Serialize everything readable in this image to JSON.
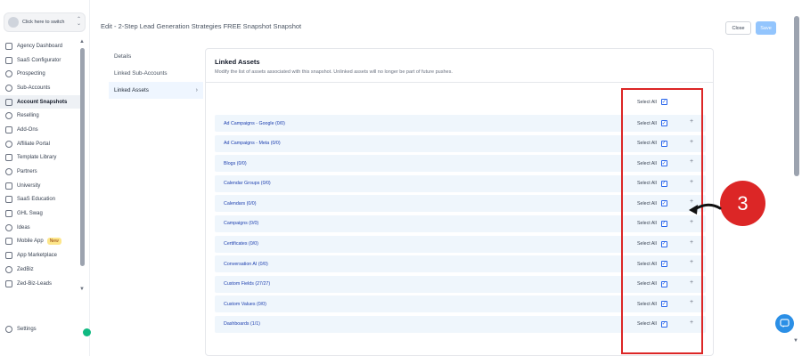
{
  "sidebar": {
    "switcher_label": "Click here to switch",
    "items": [
      {
        "label": "Agency Dashboard",
        "icon": "dashboard-icon"
      },
      {
        "label": "SaaS Configurator",
        "icon": "config-icon"
      },
      {
        "label": "Prospecting",
        "icon": "prospecting-icon"
      },
      {
        "label": "Sub-Accounts",
        "icon": "user-icon"
      },
      {
        "label": "Account Snapshots",
        "icon": "snapshot-icon",
        "active": true
      },
      {
        "label": "Reselling",
        "icon": "reselling-icon"
      },
      {
        "label": "Add-Ons",
        "icon": "addons-icon"
      },
      {
        "label": "Affiliate Portal",
        "icon": "affiliate-icon"
      },
      {
        "label": "Template Library",
        "icon": "template-icon"
      },
      {
        "label": "Partners",
        "icon": "partners-icon"
      },
      {
        "label": "University",
        "icon": "university-icon"
      },
      {
        "label": "SaaS Education",
        "icon": "education-icon"
      },
      {
        "label": "GHL Swag",
        "icon": "swag-icon"
      },
      {
        "label": "Ideas",
        "icon": "ideas-icon"
      },
      {
        "label": "Mobile App",
        "icon": "mobile-icon",
        "badge": "New"
      },
      {
        "label": "App Marketplace",
        "icon": "marketplace-icon"
      },
      {
        "label": "ZedBiz",
        "icon": "zedbiz-icon"
      },
      {
        "label": "Zed-Biz-Leads",
        "icon": "leads-icon"
      }
    ],
    "settings_label": "Settings"
  },
  "header": {
    "title": "Edit - 2-Step Lead Generation Strategies FREE Snapshot Snapshot",
    "close_label": "Close",
    "save_label": "Save"
  },
  "tabs": [
    {
      "label": "Details"
    },
    {
      "label": "Linked Sub-Accounts"
    },
    {
      "label": "Linked Assets",
      "active": true
    }
  ],
  "panel": {
    "title": "Linked Assets",
    "subtitle": "Modify the list of assets associated with this snapshot. Unlinked assets will no longer be part of future pushes.",
    "select_all_label": "Select All",
    "rows": [
      {
        "label": "Ad Campaigns - Google (0/0)",
        "select_label": "Select All",
        "checked": true
      },
      {
        "label": "Ad Campaigns - Meta (0/0)",
        "select_label": "Select All",
        "checked": true
      },
      {
        "label": "Blogs (0/0)",
        "select_label": "Select All",
        "checked": true
      },
      {
        "label": "Calendar Groups (0/0)",
        "select_label": "Select All",
        "checked": true
      },
      {
        "label": "Calendars (0/0)",
        "select_label": "Select All",
        "checked": true
      },
      {
        "label": "Campaigns (0/0)",
        "select_label": "Select All",
        "checked": true
      },
      {
        "label": "Certificates (0/0)",
        "select_label": "Select All",
        "checked": true
      },
      {
        "label": "Conversation AI (0/0)",
        "select_label": "Select All",
        "checked": true
      },
      {
        "label": "Custom Fields (27/27)",
        "select_label": "Select All",
        "checked": true
      },
      {
        "label": "Custom Values (0/0)",
        "select_label": "Select All",
        "checked": true
      },
      {
        "label": "Dashboards (1/1)",
        "select_label": "Select All",
        "checked": true
      }
    ]
  },
  "annotation": {
    "step_number": "3",
    "highlight_color": "#dc2626"
  }
}
